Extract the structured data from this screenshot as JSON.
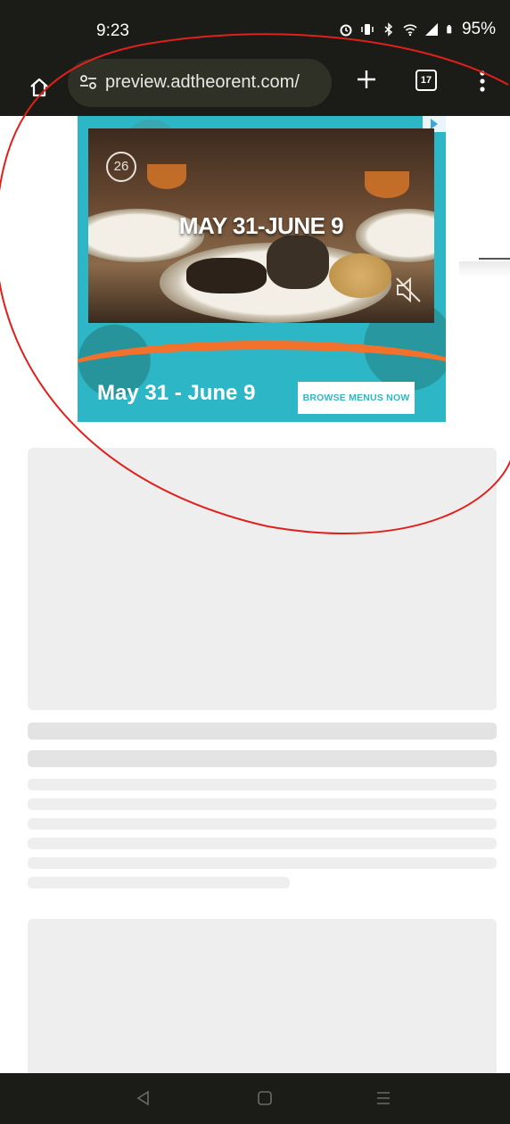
{
  "status_bar": {
    "time": "9:23",
    "battery": "95%",
    "icons": [
      "alarm-icon",
      "vibrate-icon",
      "bluetooth-icon",
      "wifi-icon",
      "signal-icon",
      "battery-icon"
    ]
  },
  "browser": {
    "url": "preview.adtheorent.com/",
    "tab_count": "17",
    "icons": [
      "home-icon",
      "site-settings-icon",
      "plus-icon",
      "tabs-icon",
      "more-vert-icon"
    ]
  },
  "ad": {
    "countdown": "26",
    "video_headline": "MAY 31-JUNE 9",
    "dates": "May 31 - June 9",
    "cta_label": "BROWSE MENUS NOW",
    "colors": {
      "background": "#2db7c6",
      "accent": "#f2712c",
      "cta_text": "#2db7c6"
    }
  },
  "annotation": {
    "shape": "ellipse",
    "color": "#e0201b"
  },
  "navigation": {
    "icons": [
      "back-icon",
      "home-square-icon",
      "recents-icon"
    ]
  }
}
